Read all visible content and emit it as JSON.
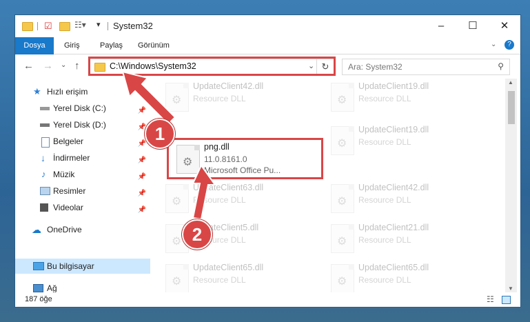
{
  "window": {
    "title": "System32"
  },
  "ribbon": {
    "tabs": [
      "Dosya",
      "Giriş",
      "Paylaş",
      "Görünüm"
    ]
  },
  "address": {
    "path": "C:\\Windows\\System32"
  },
  "search": {
    "placeholder": "Ara: System32"
  },
  "nav": {
    "quick_access": "Hızlı erişim",
    "items": [
      "Yerel Disk (C:)",
      "Yerel Disk (D:)",
      "Belgeler",
      "İndirmeler",
      "Müzik",
      "Resimler",
      "Videolar"
    ],
    "onedrive": "OneDrive",
    "this_pc": "Bu bilgisayar",
    "network": "Ağ"
  },
  "files": {
    "left": [
      {
        "name": "UpdateClient42.dll",
        "desc": "Resource DLL"
      },
      {
        "name": "png.dll",
        "version": "11.0.8161.0",
        "desc": "Microsoft Office Pu..."
      },
      {
        "name": "UpdateClient63.dll",
        "desc": "Resource DLL"
      },
      {
        "name": "UpdateClient5.dll",
        "desc": "Resource DLL"
      },
      {
        "name": "UpdateClient65.dll",
        "desc": "Resource DLL"
      }
    ],
    "right": [
      {
        "name": "UpdateClient19.dll",
        "desc": "Resource DLL"
      },
      {
        "name": "UpdateClient19.dll",
        "desc": "Resource DLL"
      },
      {
        "name": "UpdateClient42.dll",
        "desc": "Resource DLL"
      },
      {
        "name": "UpdateClient21.dll",
        "desc": "Resource DLL"
      },
      {
        "name": "UpdateClient65.dll",
        "desc": "Resource DLL"
      }
    ]
  },
  "status": {
    "count": "187 öğe"
  },
  "callouts": {
    "one": "1",
    "two": "2"
  },
  "colors": {
    "accent": "#1979ca",
    "highlight": "#d94646",
    "selected": "#cce8ff"
  }
}
